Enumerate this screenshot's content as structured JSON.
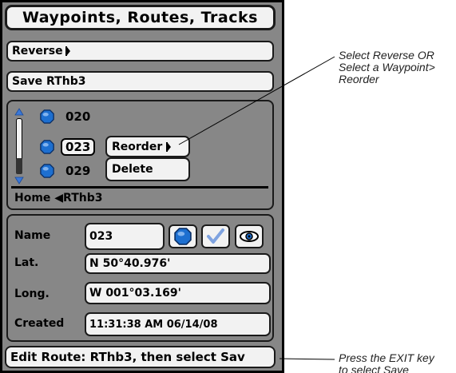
{
  "title": "Waypoints, Routes, Tracks",
  "menu": {
    "reverse_label": "Reverse",
    "save_label": "Save RThb3"
  },
  "waypoint_list": {
    "items": [
      {
        "number": "020",
        "selected": false
      },
      {
        "number": "023",
        "selected": true
      },
      {
        "number": "029",
        "selected": false
      }
    ],
    "submenu": {
      "reorder_label": "Reorder",
      "delete_label": "Delete"
    },
    "route_line": "Home ◀RThb3"
  },
  "details": {
    "name_label": "Name",
    "name_value": "023",
    "lat_label": "Lat.",
    "lat_value": "N 50°40.976'",
    "long_label": "Long.",
    "long_value": "W 001°03.169'",
    "created_label": "Created",
    "created_value": "11:31:38 AM 06/14/08"
  },
  "status_bar": "Edit Route: RThb3, then select Sav",
  "callouts": {
    "top": [
      "Select Reverse OR",
      "Select a Waypoint>",
      "Reorder"
    ],
    "bottom": [
      "Press the EXIT key",
      "to select Save"
    ]
  },
  "colors": {
    "face": "#878787",
    "field": "#f2f2f2",
    "waypoint_icon": "#1d6fd0",
    "checkmark": "#7fa3e0"
  }
}
